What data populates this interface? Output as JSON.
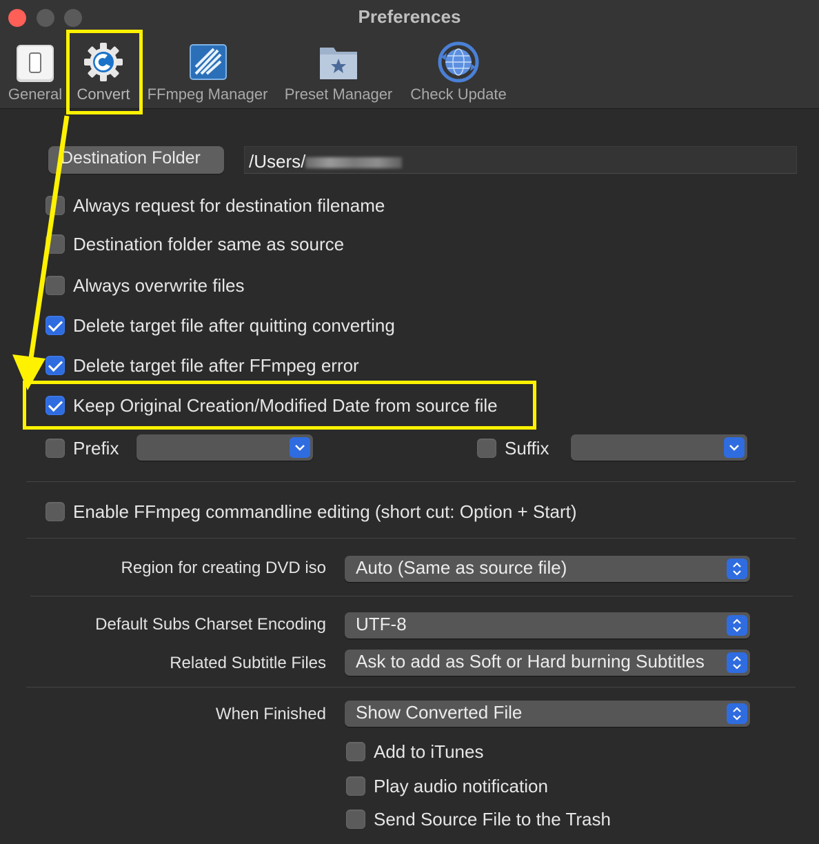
{
  "window": {
    "title": "Preferences"
  },
  "toolbar": {
    "items": [
      {
        "label": "General",
        "icon": "switch-icon"
      },
      {
        "label": "Convert",
        "icon": "gear-icon"
      },
      {
        "label": "FFmpeg Manager",
        "icon": "ffmpeg-icon"
      },
      {
        "label": "Preset Manager",
        "icon": "star-folder-icon"
      },
      {
        "label": "Check Update",
        "icon": "globe-refresh-icon"
      }
    ],
    "selected": "Convert"
  },
  "destination": {
    "button_label": "Destination Folder",
    "path_value": "/Users/"
  },
  "options": [
    {
      "label": "Always request for destination filename",
      "checked": false
    },
    {
      "label": "Destination folder same as source",
      "checked": false
    },
    {
      "label": "Always overwrite files",
      "checked": false
    },
    {
      "label": "Delete target file after quitting converting",
      "checked": true
    },
    {
      "label": "Delete target file after FFmpeg error",
      "checked": true
    },
    {
      "label": "Keep Original Creation/Modified Date from source file",
      "checked": true
    }
  ],
  "prefix": {
    "label": "Prefix",
    "checked": false,
    "value": ""
  },
  "suffix": {
    "label": "Suffix",
    "checked": false,
    "value": ""
  },
  "ffmpeg_edit": {
    "label": "Enable FFmpeg commandline editing (short cut: Option + Start)",
    "checked": false
  },
  "dvd_region": {
    "label": "Region for creating DVD iso",
    "value": "Auto (Same as source file)"
  },
  "subs_charset": {
    "label": "Default Subs Charset Encoding",
    "value": "UTF-8"
  },
  "related_subs": {
    "label": "Related Subtitle Files",
    "value": "Ask to add as Soft or Hard burning Subtitles"
  },
  "when_finished": {
    "label": "When Finished",
    "value": "Show Converted File",
    "options": [
      {
        "label": "Add to iTunes",
        "checked": false
      },
      {
        "label": "Play audio notification",
        "checked": false
      },
      {
        "label": "Send Source File to the Trash",
        "checked": false
      }
    ]
  },
  "colors": {
    "accent": "#2f6ce0",
    "highlight": "#fff200",
    "background": "#2b2b2b"
  }
}
